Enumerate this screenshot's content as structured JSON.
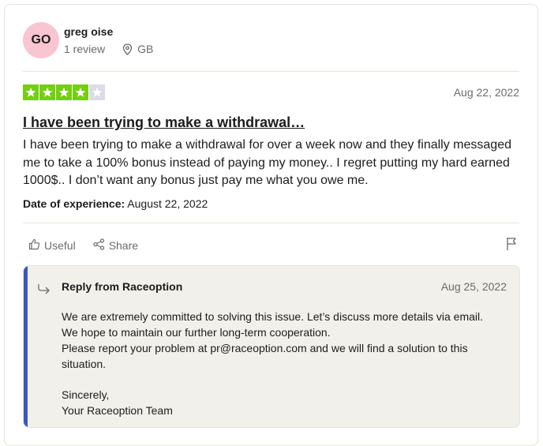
{
  "reviewer": {
    "initials": "GO",
    "name": "greg oise",
    "review_count": "1 review",
    "country": "GB"
  },
  "review": {
    "rating": 4,
    "max_rating": 5,
    "date": "Aug 22, 2022",
    "title": "I have been trying to make a withdrawal…",
    "body": "I have been trying to make a withdrawal for over a week now and they finally messaged me to take a 100% bonus instead of paying my money.. I regret putting my hard earned 1000$.. I don’t want any bonus just pay me what you owe me.",
    "experience_label": "Date of experience:",
    "experience_date": "August 22, 2022"
  },
  "actions": {
    "useful_label": "Useful",
    "share_label": "Share"
  },
  "reply": {
    "from": "Reply from Raceoption",
    "date": "Aug 25, 2022",
    "line1": "We are extremely committed to solving this issue. Let’s discuss more details via email.",
    "line2": "We hope to maintain our further long-term cooperation.",
    "line3": "Please report your problem at pr@raceoption.com and we will find a solution to this situation.",
    "closing": "Sincerely,",
    "signature": "Your Raceoption Team"
  },
  "colors": {
    "star_on": "#73cf11",
    "star_off": "#dcdce6",
    "reply_accent": "#3c57bc",
    "avatar_bg": "#f9c5d3"
  }
}
